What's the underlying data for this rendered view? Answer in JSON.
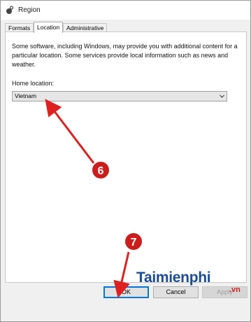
{
  "window": {
    "title": "Region",
    "icon": "region-globe-icon"
  },
  "tabs": [
    {
      "label": "Formats",
      "active": false
    },
    {
      "label": "Location",
      "active": true
    },
    {
      "label": "Administrative",
      "active": false
    }
  ],
  "location": {
    "description": "Some software, including Windows, may provide you with additional content for a particular location. Some services provide local information such as news and weather.",
    "home_label": "Home location:",
    "home_value": "Vietnam",
    "dropdown_icon": "chevron-down-icon"
  },
  "buttons": {
    "ok": "OK",
    "cancel": "Cancel",
    "apply": "Apply"
  },
  "annotations": {
    "step1": "6",
    "step2": "7",
    "arrow_color": "#e02020",
    "badge_color": "#cc1c1c"
  },
  "watermark": {
    "main": "Taimienphi",
    "sub": ".vn"
  }
}
